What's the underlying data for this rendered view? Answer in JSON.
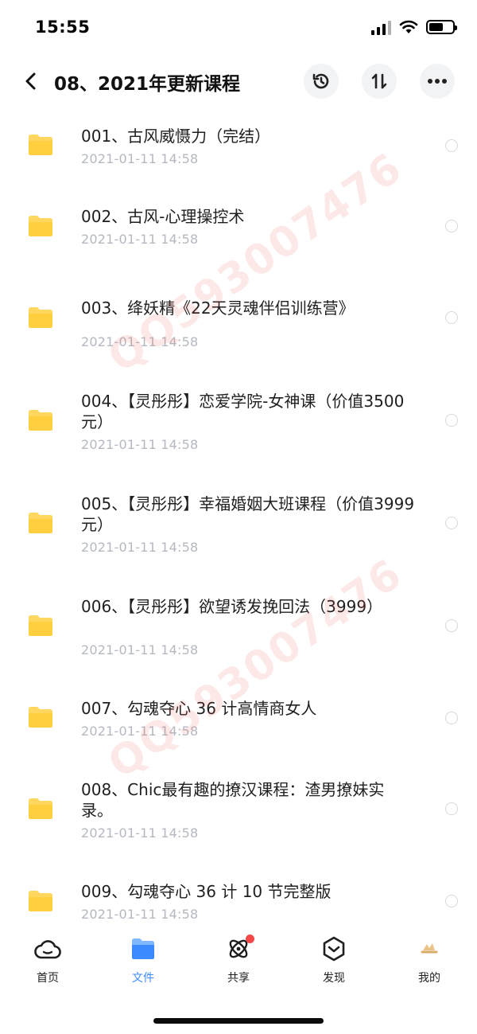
{
  "status_bar": {
    "time": "15:55"
  },
  "header": {
    "title": "08、2021年更新课程"
  },
  "files": [
    {
      "name": "001、古风威慑力（完结）",
      "date": "2021-01-11 14:58"
    },
    {
      "name": "002、古风-心理操控术",
      "date": "2021-01-11 14:58"
    },
    {
      "name": "003、绛妖精《22天灵魂伴侣训练营》",
      "date": "2021-01-11 14:58"
    },
    {
      "name": "004、【灵彤彤】恋爱学院-女神课（价值3500元）",
      "date": "2021-01-11 14:58"
    },
    {
      "name": "005、【灵彤彤】幸福婚姻大班课程（价值3999元）",
      "date": "2021-01-11 14:58"
    },
    {
      "name": "006、【灵彤彤】欲望诱发挽回法（3999）",
      "date": "2021-01-11 14:58"
    },
    {
      "name": "007、勾魂夺心 36 计高情商女人",
      "date": "2021-01-11 14:58"
    },
    {
      "name": "008、Chic最有趣的撩汉课程：渣男撩妹实录。",
      "date": "2021-01-11 14:58"
    },
    {
      "name": "009、勾魂夺心 36 计 10 节完整版",
      "date": "2021-01-11 14:58"
    }
  ],
  "watermark": {
    "text": "QQ593007476"
  },
  "tabs": [
    {
      "label": "首页",
      "icon": "cloud-icon"
    },
    {
      "label": "文件",
      "icon": "folder-icon"
    },
    {
      "label": "共享",
      "icon": "atom-icon"
    },
    {
      "label": "发现",
      "icon": "compass-icon"
    },
    {
      "label": "我的",
      "icon": "avatar-icon"
    }
  ],
  "colors": {
    "accent": "#3b8bff",
    "folder": "#ffd75e",
    "badge": "#f04848",
    "date": "#b4b8c0"
  }
}
